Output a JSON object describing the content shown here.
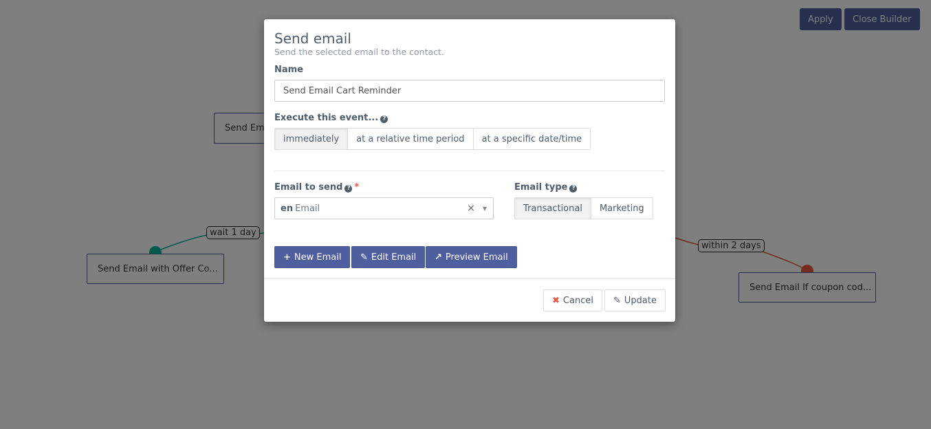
{
  "toolbar": {
    "apply_label": "Apply",
    "close_builder_label": "Close Builder"
  },
  "canvas": {
    "nodes": [
      {
        "label": "Send Email Cart Reminder"
      },
      {
        "label": "Send Email with Offer Co..."
      },
      {
        "label": "Send Email If coupon cod..."
      }
    ],
    "edges": [
      {
        "label": "wait 1 day",
        "color": "#00b49c"
      },
      {
        "label": "within 2 days",
        "color": "#e8573f"
      }
    ]
  },
  "modal": {
    "title": "Send email",
    "subtitle": "Send the selected email to the contact.",
    "name_label": "Name",
    "name_value": "Send Email Cart Reminder",
    "execute_label": "Execute this event...",
    "execute_options": [
      {
        "label": "immediately",
        "active": true
      },
      {
        "label": "at a relative time period",
        "active": false
      },
      {
        "label": "at a specific date/time",
        "active": false
      }
    ],
    "email_to_send_label": "Email to send",
    "required_mark": "*",
    "email_select": {
      "lang": "en",
      "value": "Email",
      "clear_icon": "×",
      "caret_icon": "▼"
    },
    "email_type_label": "Email type",
    "email_type_options": [
      {
        "label": "Transactional",
        "active": true
      },
      {
        "label": "Marketing",
        "active": false
      }
    ],
    "actions": {
      "new_email": "New Email",
      "edit_email": "Edit Email",
      "preview_email": "Preview Email"
    },
    "footer": {
      "cancel": "Cancel",
      "update": "Update"
    }
  },
  "colors": {
    "primary": "#4e5e9e",
    "danger": "#e8573f",
    "success": "#00b49c"
  }
}
